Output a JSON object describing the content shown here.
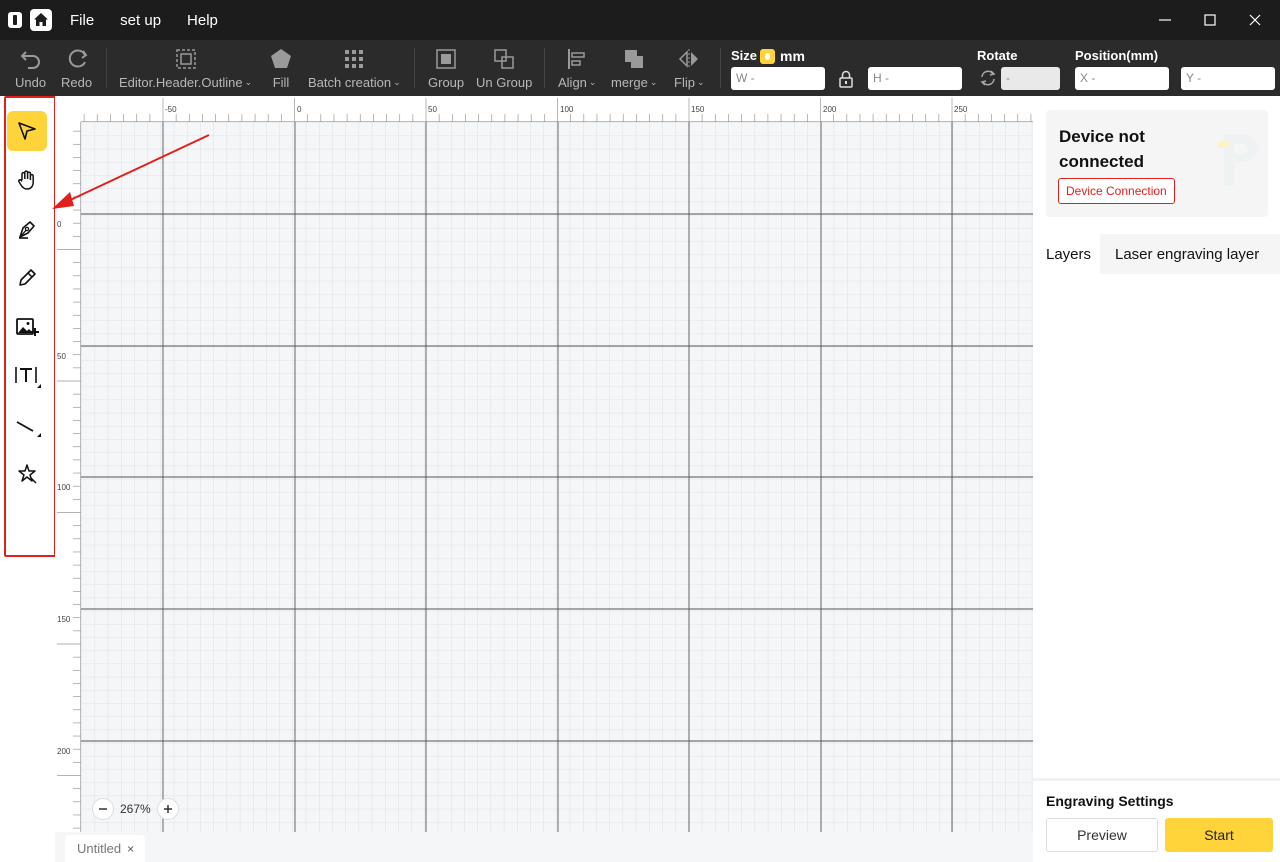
{
  "menu": {
    "file": "File",
    "setup": "set up",
    "help": "Help"
  },
  "toolbar": {
    "undo": "Undo",
    "redo": "Redo",
    "outline": "Editor.Header.Outline",
    "fill": "Fill",
    "batch": "Batch creation",
    "group": "Group",
    "ungroup": "Un Group",
    "align": "Align",
    "merge": "merge",
    "flip": "Flip",
    "size_label": "Size",
    "size_unit": "mm",
    "w_placeholder": "W -",
    "h_placeholder": "H -",
    "rotate_label": "Rotate",
    "rotate_placeholder": "-",
    "position_label": "Position(mm)",
    "x_placeholder": "X -",
    "y_placeholder": "Y -"
  },
  "tools": [
    {
      "name": "select-tool",
      "icon": "pointer-icon"
    },
    {
      "name": "pan-tool",
      "icon": "hand-icon"
    },
    {
      "name": "pen-tool",
      "icon": "pen-nib-icon"
    },
    {
      "name": "pencil-tool",
      "icon": "pencil-icon"
    },
    {
      "name": "image-tool",
      "icon": "image-add-icon"
    },
    {
      "name": "text-tool",
      "icon": "text-icon"
    },
    {
      "name": "line-tool",
      "icon": "line-icon"
    },
    {
      "name": "shape-tool",
      "icon": "star-shape-icon"
    }
  ],
  "ruler": {
    "top_labels": [
      "-50",
      "0",
      "50",
      "100",
      "150",
      "200",
      "250"
    ],
    "left_labels": [
      "0",
      "50",
      "100",
      "150",
      "200"
    ]
  },
  "zoom": {
    "value": "267%"
  },
  "document_tab": {
    "title": "Untitled",
    "close": "×"
  },
  "device": {
    "status": "Device not connected",
    "button": "Device Connection"
  },
  "panel_tabs": {
    "layers": "Layers",
    "laser": "Laser engraving layer"
  },
  "engrave": {
    "title": "Engraving Settings",
    "preview": "Preview",
    "start": "Start"
  },
  "colors": {
    "accent": "#ffd43b",
    "annotation": "#e0201b",
    "titlebar": "#1c1c1c",
    "toolbar": "#2b2b2b"
  }
}
